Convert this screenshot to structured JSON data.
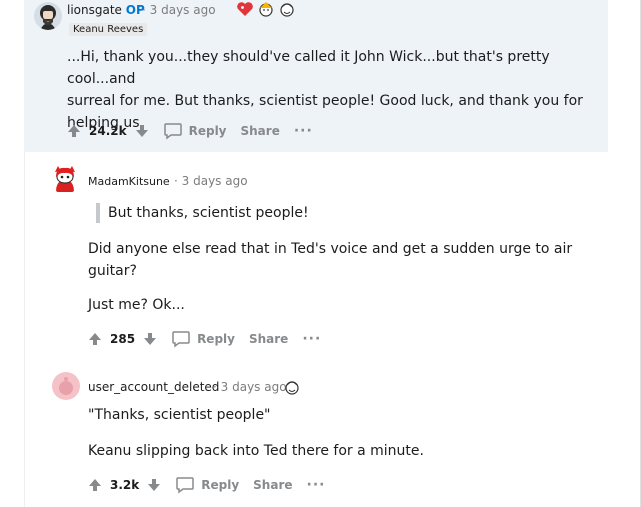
{
  "comments": [
    {
      "username": "lionsgate",
      "op_label": "OP",
      "separator": "·",
      "time": "3 days ago",
      "flair": "Keanu Reeves",
      "body": [
        "...Hi, thank you...they should've called it John Wick...but that's pretty cool...and",
        "surreal for me. But thanks, scientist people! Good luck, and thank you for",
        "helping us."
      ],
      "score": "24.2k",
      "reply_label": "Reply",
      "share_label": "Share",
      "more_label": "···"
    },
    {
      "username": "MadamKitsune",
      "separator": "·",
      "time": "3 days ago",
      "quote": "But thanks, scientist people!",
      "body": [
        "Did anyone else read that in Ted's voice and get a sudden urge to air",
        "guitar?"
      ],
      "body2": "Just me? Ok...",
      "score": "285",
      "reply_label": "Reply",
      "share_label": "Share",
      "more_label": "···"
    },
    {
      "username": "user_account_deleted",
      "separator": "·",
      "time": "3 days ago",
      "body": "\"Thanks, scientist people\"",
      "body2": "Keanu slipping back into Ted there for a minute.",
      "score": "3.2k",
      "reply_label": "Reply",
      "share_label": "Share",
      "more_label": "···"
    }
  ],
  "colors": {
    "op": "#0079d3",
    "meta": "#7c7c7c",
    "highlight_bg": "#eef3f8",
    "action": "#878a8c"
  },
  "icons": [
    "upvote-icon",
    "downvote-icon",
    "comment-bubble-icon",
    "award-icon",
    "avatar-icon"
  ]
}
